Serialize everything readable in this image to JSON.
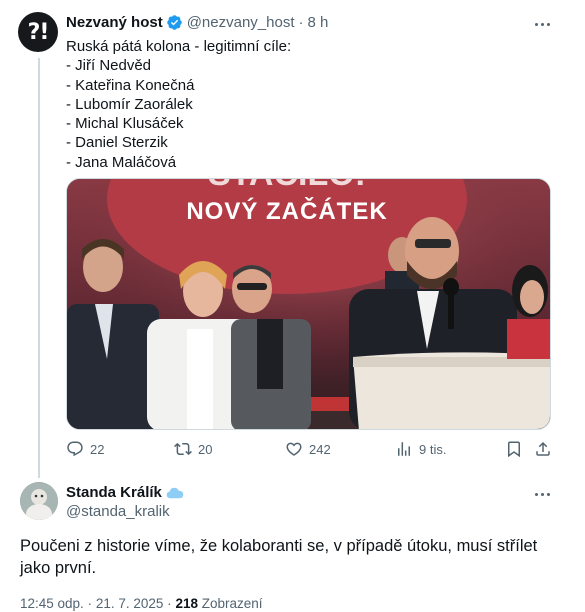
{
  "parent_tweet": {
    "avatar_text": "?!",
    "author_name": "Nezvaný host",
    "handle": "@nezvany_host",
    "separator": "·",
    "time": "8 h",
    "lines": [
      "Ruská pátá kolona - legitimní cíle:",
      "- Jiří Nedvěd",
      "- Kateřina Konečná",
      "- Lubomír Zaorálek",
      "- Michal Klusáček",
      "- Daniel Sterzik",
      "- Jana Maláčová"
    ],
    "image": {
      "banner_text_top": "STAČILO!",
      "banner_text": "NOVÝ ZAČÁTEK"
    },
    "actions": {
      "replies": "22",
      "reposts": "20",
      "likes": "242",
      "views": "9 tis."
    },
    "icons": [
      "more-icon",
      "verified-icon",
      "reply-icon",
      "repost-icon",
      "like-icon",
      "views-icon",
      "bookmark-icon",
      "share-icon"
    ]
  },
  "reply_tweet": {
    "author_name": "Standa Králík",
    "handle": "@standa_kralik",
    "text": "Poučeni z historie víme, že kolaboranti se, v případě útoku, musí střílet jako první.",
    "time": "12:45 odp.",
    "separator": "·",
    "date": "21. 7. 2025",
    "separator2": "·",
    "views_count": "218",
    "views_label": "Zobrazení"
  },
  "colors": {
    "text": "#0f1419",
    "secondary": "#536471",
    "verified": "#1d9bf0",
    "border": "#cfd9de"
  }
}
